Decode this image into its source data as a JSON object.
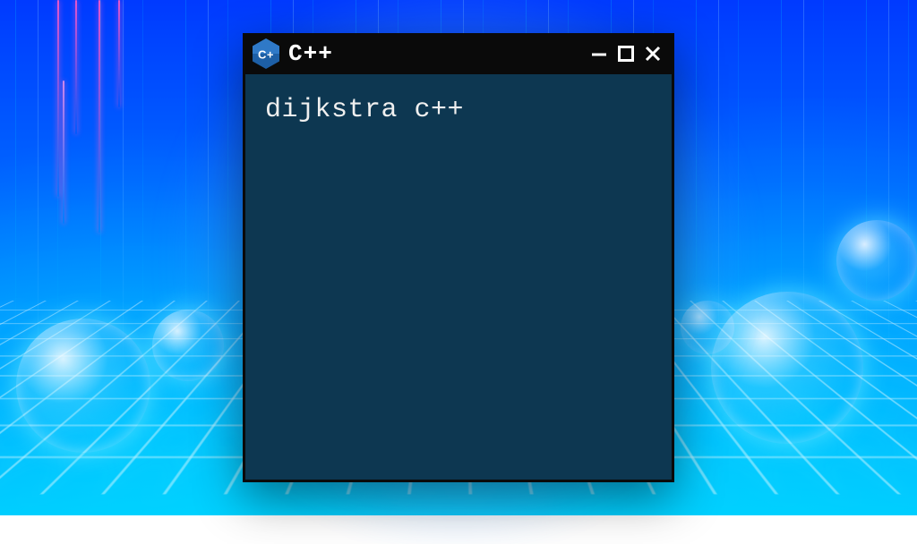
{
  "window": {
    "title": "C++",
    "icon_letter": "C+",
    "content": "dijkstra c++"
  },
  "colors": {
    "terminal_bg": "#0d3751",
    "titlebar_bg": "#0a0a0a",
    "text": "#efefef",
    "accent_blue": "#0a8cff"
  }
}
